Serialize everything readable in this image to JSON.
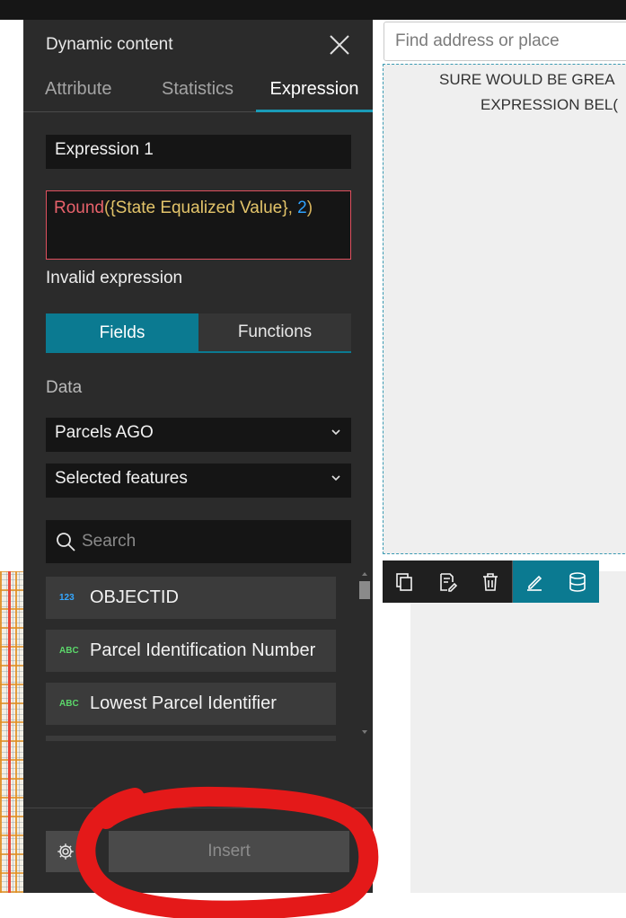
{
  "search": {
    "placeholder": "Find address or place"
  },
  "text_widget": {
    "line1": "SURE WOULD BE GREA",
    "line2": "EXPRESSION BEL("
  },
  "panel": {
    "title": "Dynamic content",
    "tabs": [
      {
        "label": "Attribute",
        "active": false
      },
      {
        "label": "Statistics",
        "active": false
      },
      {
        "label": "Expression",
        "active": true
      }
    ],
    "expression_name": "Expression 1",
    "code": {
      "fn": "Round",
      "open": "(",
      "field": "{State Equalized Value}",
      "comma": ", ",
      "num": "2",
      "close": ")"
    },
    "validation_message": "Invalid expression",
    "segments": {
      "fields": "Fields",
      "functions": "Functions"
    },
    "data_label": "Data",
    "data_source": "Parcels AGO",
    "feature_scope": "Selected features",
    "field_search_placeholder": "Search",
    "fields": [
      {
        "type_badge": "123",
        "kind": "number",
        "name": "OBJECTID"
      },
      {
        "type_badge": "ABC",
        "kind": "string",
        "name": "Parcel Identification Number"
      },
      {
        "type_badge": "ABC",
        "kind": "string",
        "name": "Lowest Parcel Identifier"
      }
    ],
    "insert_label": "Insert"
  },
  "toolbar": {
    "icons": [
      "duplicate-icon",
      "edit-content-icon",
      "delete-icon",
      "pen-icon",
      "database-icon"
    ]
  },
  "colors": {
    "accent": "#0b7a91",
    "error": "#e0505e",
    "annotation": "#e41919",
    "panel": "#2b2b2b"
  }
}
